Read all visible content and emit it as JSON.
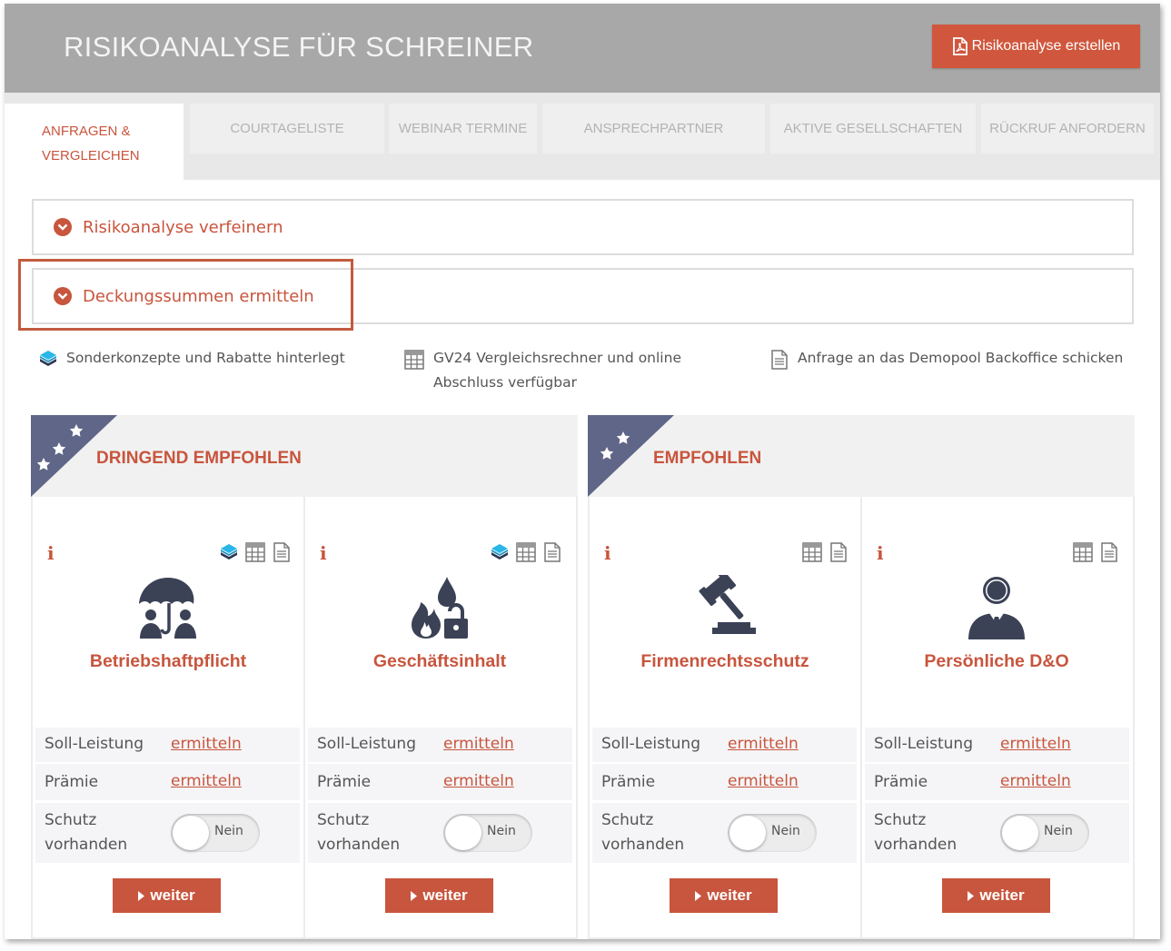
{
  "header": {
    "title": "RISIKOANALYSE FÜR SCHREINER",
    "pdf_button": "Risikoanalyse erstellen"
  },
  "tabs": [
    {
      "label": "ANFRAGEN & VERGLEICHEN",
      "active": true
    },
    {
      "label": "COURTAGELISTE"
    },
    {
      "label": "WEBINAR TERMINE"
    },
    {
      "label": "ANSPRECHPARTNER"
    },
    {
      "label": "AKTIVE GESELLSCHAFTEN"
    },
    {
      "label": "RÜCKRUF ANFORDERN"
    }
  ],
  "accordion": [
    {
      "label": "Risikoanalyse verfeinern"
    },
    {
      "label": "Deckungssummen ermitteln"
    }
  ],
  "legend": [
    {
      "icon": "layers-icon",
      "text": "Sonderkonzepte und Rabatte hinterlegt"
    },
    {
      "icon": "calculator-icon",
      "text_line1": "GV24 Vergleichsrechner und online",
      "text_line2": "Abschluss verfügbar"
    },
    {
      "icon": "document-icon",
      "text": "Anfrage an das Demopool Backoffice schicken"
    }
  ],
  "panels": [
    {
      "title": "DRINGEND EMPFOHLEN",
      "stars": 3,
      "cards": [
        {
          "title": "Betriebshaftpflicht",
          "icon": "umbrella-people-icon",
          "has_layers": true
        },
        {
          "title": "Geschäftsinhalt",
          "icon": "fire-water-lock-icon",
          "has_layers": true
        }
      ]
    },
    {
      "title": "EMPFOHLEN",
      "stars": 2,
      "cards": [
        {
          "title": "Firmenrechtsschutz",
          "icon": "gavel-icon",
          "has_layers": false
        },
        {
          "title": "Persönliche D&O",
          "icon": "businessman-icon",
          "has_layers": false
        }
      ]
    }
  ],
  "card_labels": {
    "soll_leistung": "Soll-Leistung",
    "praemie": "Prämie",
    "schutz_line1": "Schutz",
    "schutz_line2": "vorhanden",
    "link": "ermitteln",
    "toggle": "Nein",
    "weiter": "weiter",
    "info": "i"
  },
  "colors": {
    "accent": "#c8553d",
    "header_bg": "#a8a8a8",
    "ribbon": "#5f6688"
  }
}
